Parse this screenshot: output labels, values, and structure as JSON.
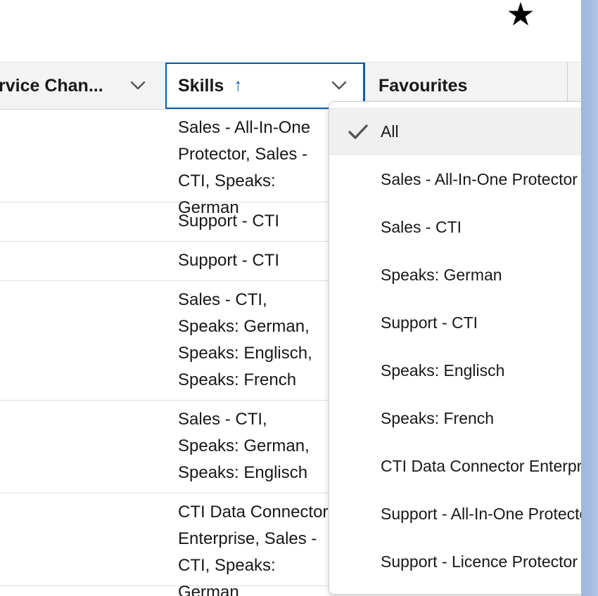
{
  "header": {
    "service_label": "rvice Chan...",
    "skills_label": "Skills",
    "skills_sort_arrow": "↑",
    "favourites_label": "Favourites"
  },
  "rows": [
    {
      "skills": "Sales - All-In-One Protector, Sales - CTI, Speaks: German"
    },
    {
      "skills": "Support - CTI"
    },
    {
      "skills": "Support - CTI"
    },
    {
      "skills": "Sales - CTI, Speaks: German, Speaks: Englisch, Speaks: French"
    },
    {
      "skills": "Sales - CTI, Speaks: German, Speaks: Englisch"
    },
    {
      "skills": "CTI Data Connector Enterprise, Sales - CTI, Speaks: German"
    }
  ],
  "dropdown": {
    "options": [
      {
        "label": "All",
        "selected": true
      },
      {
        "label": "Sales - All-In-One Protector",
        "selected": false
      },
      {
        "label": "Sales - CTI",
        "selected": false
      },
      {
        "label": "Speaks: German",
        "selected": false
      },
      {
        "label": "Support - CTI",
        "selected": false
      },
      {
        "label": "Speaks: Englisch",
        "selected": false
      },
      {
        "label": "Speaks: French",
        "selected": false
      },
      {
        "label": "CTI Data Connector Enterprise",
        "selected": false
      },
      {
        "label": "Support - All-In-One Protector",
        "selected": false
      },
      {
        "label": "Support - Licence Protector",
        "selected": false
      }
    ]
  },
  "colors": {
    "accent": "#0b5cab",
    "header_bg": "#f3f3f3",
    "selected_option_bg": "#f0f0f0"
  }
}
